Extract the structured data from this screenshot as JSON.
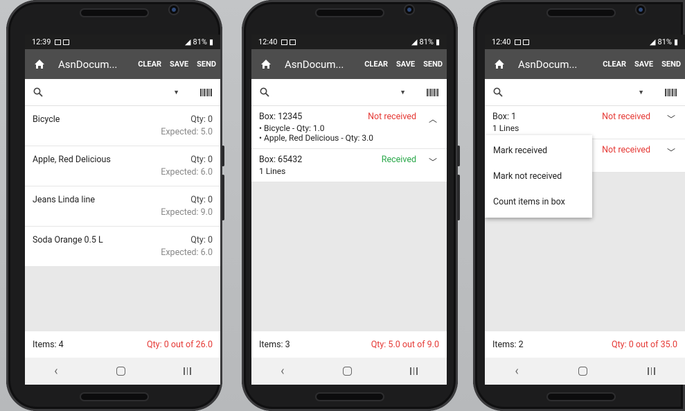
{
  "phones": [
    {
      "status": {
        "time": "12:39",
        "battery": "81%"
      },
      "appbar": {
        "title": "AsnDocum...",
        "clear": "CLEAR",
        "save": "SAVE",
        "send": "SEND"
      },
      "items": [
        {
          "name": "Bicycle",
          "qty": "Qty: 0",
          "expected": "Expected: 5.0"
        },
        {
          "name": "Apple, Red Delicious",
          "qty": "Qty: 0",
          "expected": "Expected: 6.0"
        },
        {
          "name": "Jeans Linda line",
          "qty": "Qty: 0",
          "expected": "Expected: 9.0"
        },
        {
          "name": "Soda Orange 0.5 L",
          "qty": "Qty: 0",
          "expected": "Expected: 6.0"
        }
      ],
      "footer": {
        "items": "Items: 4",
        "total": "Qty: 0 out of 26.0"
      }
    },
    {
      "status": {
        "time": "12:40",
        "battery": "81%"
      },
      "appbar": {
        "title": "AsnDocum...",
        "clear": "CLEAR",
        "save": "SAVE",
        "send": "SEND"
      },
      "boxes": [
        {
          "label": "Box: 12345",
          "status": "Not received",
          "lines": [
            "• Bicycle - Qty: 1.0",
            "• Apple, Red Delicious - Qty: 3.0"
          ]
        },
        {
          "label": "Box: 65432",
          "status": "Received",
          "sub": "1 Lines"
        }
      ],
      "footer": {
        "items": "Items: 3",
        "total": "Qty: 5.0 out of 9.0"
      }
    },
    {
      "status": {
        "time": "12:40",
        "battery": "81%"
      },
      "appbar": {
        "title": "AsnDocum...",
        "clear": "CLEAR",
        "save": "SAVE",
        "send": "SEND"
      },
      "boxes": [
        {
          "label": "Box: 1",
          "status": "Not received",
          "sub": "1 Lines"
        },
        {
          "status": "Not received"
        }
      ],
      "menu": [
        "Mark received",
        "Mark not received",
        "Count items in box"
      ],
      "footer": {
        "items": "Items: 2",
        "total": "Qty: 0 out of 35.0"
      }
    }
  ],
  "colors": {
    "appbar": "#4d4d4d",
    "not_received": "#e53935",
    "received": "#2aa84a"
  }
}
